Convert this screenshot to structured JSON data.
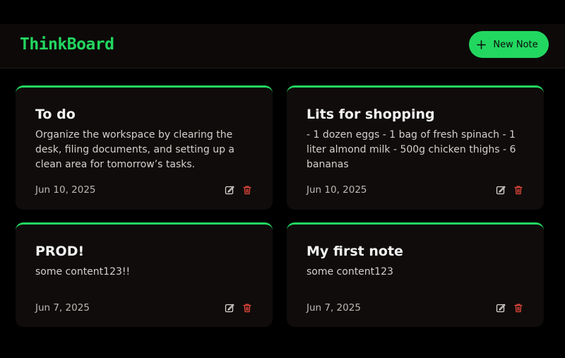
{
  "header": {
    "brand": "ThinkBoard",
    "new_note_label": "New Note",
    "brand_color": "#22d760"
  },
  "notes": [
    {
      "title": "To do",
      "content": "Organize the workspace by clearing the desk, filing documents, and setting up a clean area for tomorrow’s tasks.",
      "date": "Jun 10, 2025"
    },
    {
      "title": "Lits for shopping",
      "content": "- 1 dozen eggs - 1 bag of fresh spinach - 1 liter almond milk - 500g chicken thighs - 6 bananas",
      "date": "Jun 10, 2025"
    },
    {
      "title": "PROD!",
      "content": "some content123!!",
      "date": "Jun 7, 2025"
    },
    {
      "title": "My first note",
      "content": "some content123",
      "date": "Jun 7, 2025"
    }
  ],
  "icons": {
    "edit": "edit-icon",
    "delete": "trash-icon",
    "add": "plus-icon"
  },
  "colors": {
    "accent": "#22d760",
    "delete": "#e5483b",
    "card_bg": "#0f0c0b"
  }
}
